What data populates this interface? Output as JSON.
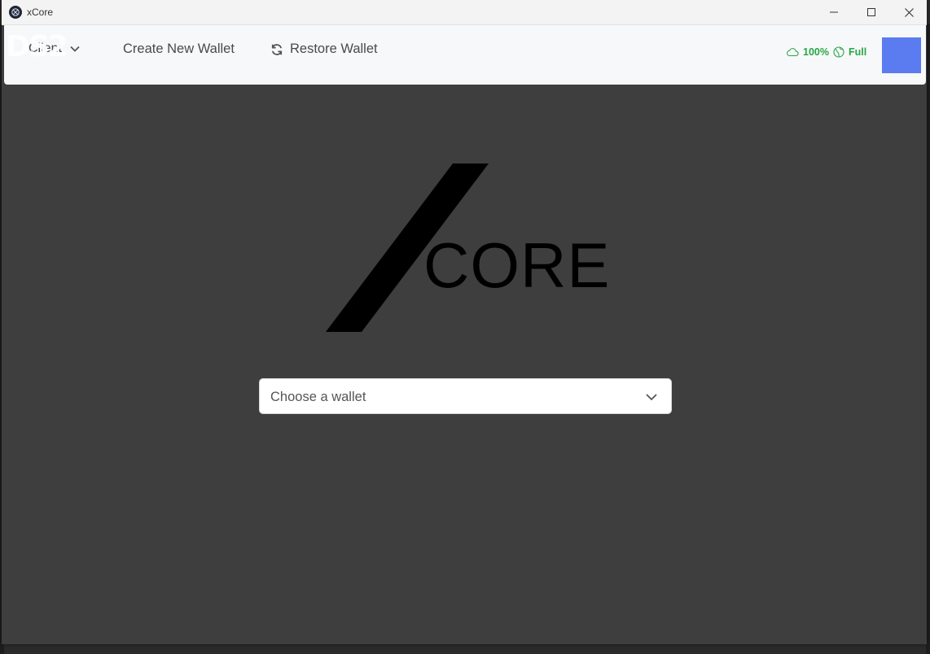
{
  "window": {
    "title": "xCore"
  },
  "navbar": {
    "client_label": "Client",
    "overlay_glyph": "DS2",
    "create_wallet": "Create New Wallet",
    "restore_wallet": "Restore Wallet",
    "sync_percent": "100%",
    "node_mode": "Full",
    "avatar_color": "#5b7cf0",
    "status_color": "#27a745"
  },
  "logo": {
    "text": "CORE"
  },
  "wallet_select": {
    "placeholder": "Choose a wallet"
  },
  "icons": {
    "cloud": "cloud-icon",
    "globe": "globe-icon",
    "refresh": "refresh-icon",
    "chevron": "chevron-down-icon"
  }
}
